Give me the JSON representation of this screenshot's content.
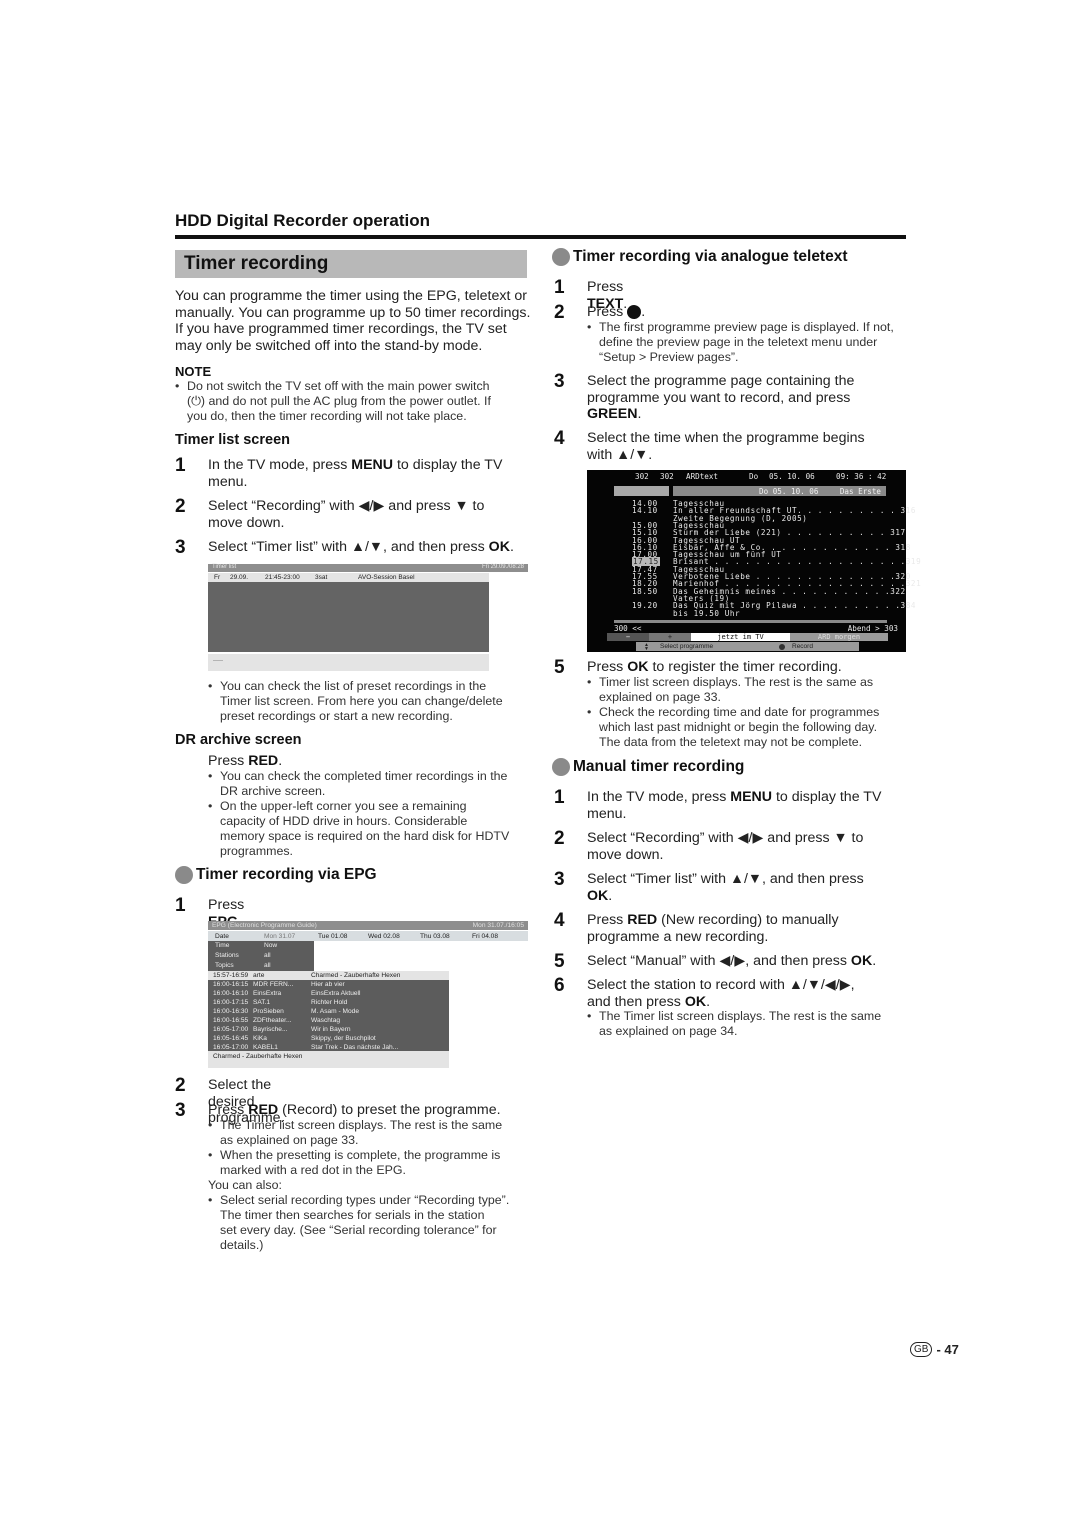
{
  "section_title": "HDD Digital Recorder operation",
  "page_title": "Timer recording",
  "intro": [
    "You can programme the timer using the EPG, teletext or",
    "manually. You can programme up to 50 timer recordings.",
    "If you have programmed timer recordings, the TV set",
    "may only be switched off into the stand-by mode."
  ],
  "note": {
    "label": "NOTE",
    "lines": [
      "Do not switch the TV set off with the main power switch",
      "(⏻) and do not pull the AC plug from the power outlet. If",
      "you do, then the timer recording will not take place."
    ]
  },
  "timer_list_section": {
    "heading": "Timer list screen",
    "steps": [
      {
        "num": "1",
        "lines": [
          "In the TV mode, press MENU to display the TV",
          "menu."
        ]
      },
      {
        "num": "2",
        "lines": [
          "Select “Recording” with ◀/▶ and press ▼ to",
          "move down."
        ]
      },
      {
        "num": "3",
        "lines": [
          "Select “Timer list” with ▲/▼, and then press OK."
        ]
      }
    ],
    "screen": {
      "title": "Timer list",
      "datetime": "Fri 29.09./08:28",
      "row": {
        "day": "Fr",
        "date": "29.09.",
        "time": "21:45-23:00",
        "station": "3sat",
        "programme": "AVO-Session Basel"
      },
      "footer": "-----"
    },
    "bullet": [
      "You can check the list of preset recordings in the",
      "Timer list screen. From here you can change/delete",
      "preset recordings or start a new recording."
    ]
  },
  "dr_archive": {
    "heading": "DR archive screen",
    "press": "Press ",
    "key": "RED",
    "bullets": [
      [
        "You can check the completed timer recordings in the",
        "DR archive screen."
      ],
      [
        "On the upper-left corner you see a remaining",
        "capacity of HDD drive in hours. Considerable",
        "memory space is required on the hard disk for HDTV",
        "programmes."
      ]
    ]
  },
  "epg_section": {
    "heading": "Timer recording via EPG",
    "step1": {
      "num": "1",
      "text": "Press ",
      "key": "EPG"
    },
    "screen": {
      "title": "EPG (Electronic Programme Guide)",
      "datetime": "Mon 31.07./16:05",
      "date_label": "Date",
      "dates": [
        "Mon 31.07",
        "Tue 01.08",
        "Wed 02.08",
        "Thu 03.08",
        "Fri 04.08"
      ],
      "filters": [
        {
          "label": "Time",
          "value": "Now"
        },
        {
          "label": "Stations",
          "value": "all"
        },
        {
          "label": "Topics",
          "value": "all"
        }
      ],
      "programmes": [
        {
          "time": "15:57-16:59",
          "station": "arte",
          "title": "Charmed - Zauberhafte Hexen",
          "selected": true
        },
        {
          "time": "16:00-16:15",
          "station": "MDR FERN...",
          "title": "Hier ab vier"
        },
        {
          "time": "16:00-16:10",
          "station": "EinsExtra",
          "title": "EinsExtra Aktuell"
        },
        {
          "time": "16:00-17:15",
          "station": "SAT.1",
          "title": "Richter Hold"
        },
        {
          "time": "16:00-16:30",
          "station": "ProSieben",
          "title": "M. Asam - Mode"
        },
        {
          "time": "16:00-16:55",
          "station": "ZDFtheater...",
          "title": "Waschtag"
        },
        {
          "time": "16:05-17:00",
          "station": "Bayrische...",
          "title": "Wir in Bayern"
        },
        {
          "time": "16:05-16:45",
          "station": "KiKa",
          "title": "Skippy, der Buschpilot"
        },
        {
          "time": "16:05-17:00",
          "station": "KABEL1",
          "title": "Star Trek - Das nächste Jah..."
        }
      ],
      "footer": "Charmed - Zauberhafte Hexen"
    },
    "step2": {
      "num": "2",
      "text": "Select the desired programme."
    },
    "step3": {
      "num": "3",
      "pre": "Press ",
      "key": "RED",
      "post": " (Record) to preset the programme."
    },
    "bullets": [
      [
        "The Timer list screen displays. The rest is the same",
        "as explained on page 33."
      ],
      [
        "When the presetting is complete, the programme is",
        "marked with a red dot in the EPG."
      ]
    ],
    "also": "You can also:",
    "also_bullet": [
      "Select serial recording types under “Recording type”.",
      "The timer then searches for serials in the station",
      "set every day. (See “Serial recording tolerance” for",
      "details.)"
    ]
  },
  "teletext_section": {
    "heading": "Timer recording via analogue teletext",
    "step1": {
      "num": "1",
      "pre": "Press ",
      "key": "TEXT",
      "post": "."
    },
    "step2": {
      "num": "2",
      "pre": "Press ",
      "post": "."
    },
    "step2_bullet": [
      "The first programme preview page is displayed. If not,",
      "define the preview page in the teletext menu under",
      "“Setup > Preview pages”."
    ],
    "step3": {
      "num": "3",
      "lines": [
        "Select the programme page containing the",
        "programme you want to record, and press"
      ],
      "key": "GREEN",
      "post": "."
    },
    "step4": {
      "num": "4",
      "lines": [
        "Select the time when the programme begins",
        "with ▲/▼."
      ]
    },
    "screen": {
      "page": "302",
      "subpage": "302",
      "service": "ARDtext",
      "day": "Do",
      "date": "05. 10. 06",
      "clock": "09: 36 : 42",
      "info_date": "Do  05. 10. 06",
      "channel": "Das Erste",
      "programmes": [
        {
          "time": "14.00",
          "title": "Tagesschau"
        },
        {
          "time": "14.10",
          "title": "In aller Freundschaft UT. . . . . . . . . . 316"
        },
        {
          "time": "",
          "title": "Zweite Begegnung (D, 2005)"
        },
        {
          "time": "15.00",
          "title": "Tagesschau"
        },
        {
          "time": "15.10",
          "title": "Sturm der Liebe (221) . . . . . . . . . . 317"
        },
        {
          "time": "16.00",
          "title": "Tagesschau UT"
        },
        {
          "time": "16.10",
          "title": "Eisbär, Affe & Co. . . . . . . . . . . . . 318"
        },
        {
          "time": "17.00",
          "title": "Tagesschau um fünf UT"
        },
        {
          "time": "17.15",
          "title": "Brisant . . . . . . . . . . . . . . . . . . .319",
          "highlighted": true
        },
        {
          "time": "17.47",
          "title": "Tagesschau"
        },
        {
          "time": "17.55",
          "title": "Verbotene Liebe . . . . . . . . . . . . . .320"
        },
        {
          "time": "18.20",
          "title": "Marienhof . . . . . . . . . . . . . . . . . .321"
        },
        {
          "time": "18.50",
          "title": "Das Geheimnis meines . . . . . . . . . . .322"
        },
        {
          "time": "",
          "title": "Vaters (19)"
        },
        {
          "time": "19.20",
          "title": "Das Quiz mit Jörg Pilawa . . . . . . . . . .384"
        },
        {
          "time": "",
          "title": "bis 19.50 Uhr"
        }
      ],
      "nav_left": "300 <<",
      "nav_right": "Abend > 303",
      "buttons": [
        "−",
        "+",
        "jetzt im TV",
        "ARD morgen"
      ],
      "legend_select": "Select programme",
      "legend_record": "Record"
    },
    "step5": {
      "num": "5",
      "pre": "Press ",
      "key": "OK",
      "post": " to register the timer recording."
    },
    "step5_bullets": [
      [
        "Timer list screen displays. The rest is the same as",
        "explained on page 33."
      ],
      [
        "Check the recording time and date for programmes",
        "which last past midnight or begin the following day.",
        "The data from the teletext may not be complete."
      ]
    ]
  },
  "manual_section": {
    "heading": "Manual timer recording",
    "steps": [
      {
        "num": "1",
        "lines": [
          "In the TV mode, press MENU to display the TV",
          "menu."
        ]
      },
      {
        "num": "2",
        "lines": [
          "Select “Recording” with ◀/▶ and press ▼ to",
          "move down."
        ]
      },
      {
        "num": "3",
        "lines": [
          "Select “Timer list” with ▲/▼, and then press",
          "OK."
        ]
      },
      {
        "num": "4",
        "lines": [
          "Press RED (New recording) to manually",
          "programme a new recording."
        ]
      },
      {
        "num": "5",
        "lines": [
          "Select “Manual” with ◀/▶, and then press OK."
        ]
      },
      {
        "num": "6",
        "lines": [
          "Select the station to record with ▲/▼/◀/▶,",
          "and then press OK."
        ]
      }
    ],
    "bullet": [
      "The Timer list screen displays. The rest is the same",
      "as explained on page 34."
    ]
  },
  "footer": {
    "region": "GB",
    "page": "- 47"
  }
}
